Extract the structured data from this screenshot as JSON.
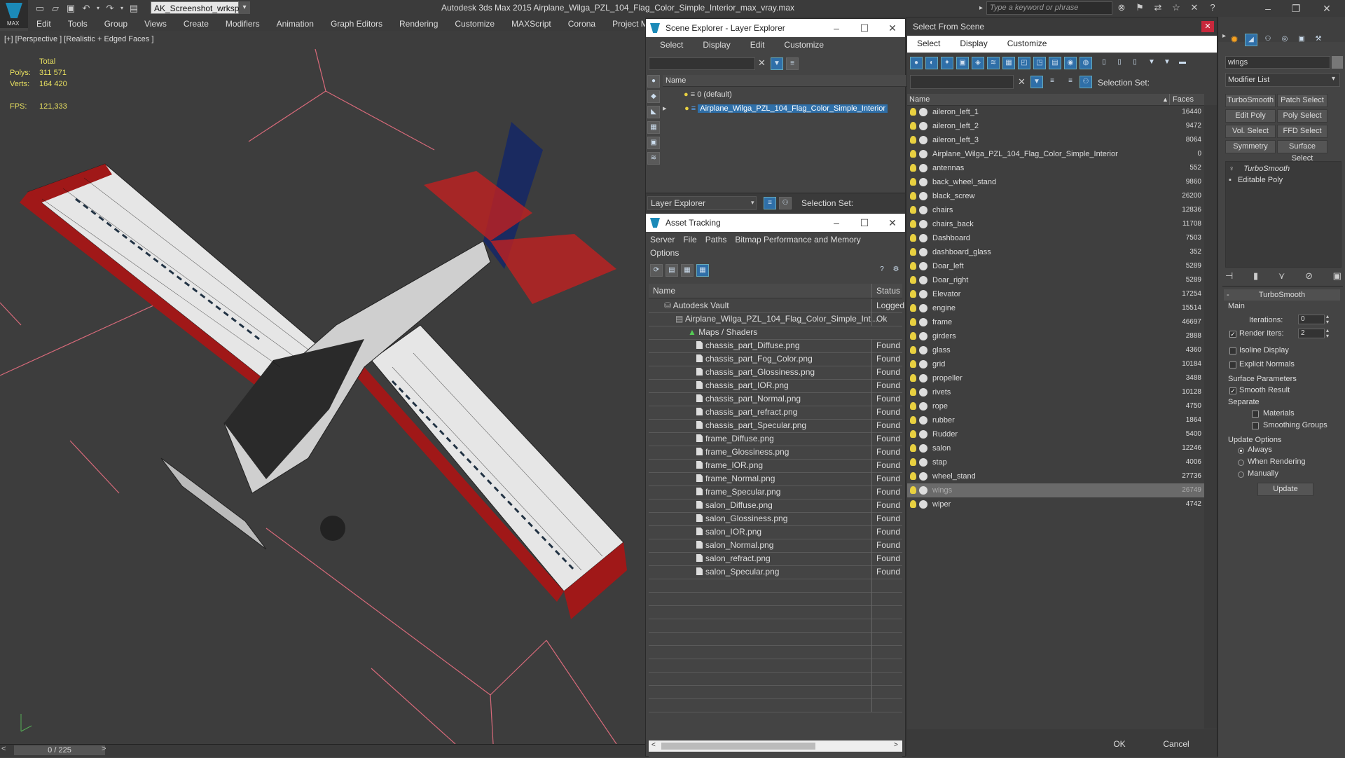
{
  "app": {
    "title": "Autodesk 3ds Max  2015    Airplane_Wilga_PZL_104_Flag_Color_Simple_Interior_max_vray.max",
    "logo_text": "MAX",
    "workspace": "AK_Screenshot_wrksp",
    "search_placeholder": "Type a keyword or phrase",
    "menus": [
      "Edit",
      "Tools",
      "Group",
      "Views",
      "Create",
      "Modifiers",
      "Animation",
      "Graph Editors",
      "Rendering",
      "Customize",
      "MAXScript",
      "Corona",
      "Project Man"
    ]
  },
  "viewport": {
    "label": "[+] [Perspective ] [Realistic + Edged Faces ]",
    "stats_total_label": "Total",
    "polys_label": "Polys:",
    "polys": "311 571",
    "verts_label": "Verts:",
    "verts": "164 420",
    "fps_label": "FPS:",
    "fps": "121,333"
  },
  "timeline": {
    "frame": "0 / 225"
  },
  "scene_explorer": {
    "title": "Scene Explorer - Layer Explorer",
    "menus": [
      "Select",
      "Display",
      "Edit",
      "Customize"
    ],
    "col_name": "Name",
    "layers": [
      "0 (default)",
      "Airplane_Wilga_PZL_104_Flag_Color_Simple_Interior"
    ],
    "footer_combo": "Layer Explorer",
    "selection_set_label": "Selection Set:"
  },
  "asset_tracking": {
    "title": "Asset Tracking",
    "menus": [
      "Server",
      "File",
      "Paths",
      "Bitmap Performance and Memory",
      "Options"
    ],
    "col_name": "Name",
    "col_status": "Status",
    "vault": {
      "name": "Autodesk Vault",
      "status": "Logged"
    },
    "file": {
      "name": "Airplane_Wilga_PZL_104_Flag_Color_Simple_Int...",
      "status": "Ok"
    },
    "group": "Maps / Shaders",
    "maps": [
      {
        "name": "chassis_part_Diffuse.png",
        "status": "Found"
      },
      {
        "name": "chassis_part_Fog_Color.png",
        "status": "Found"
      },
      {
        "name": "chassis_part_Glossiness.png",
        "status": "Found"
      },
      {
        "name": "chassis_part_IOR.png",
        "status": "Found"
      },
      {
        "name": "chassis_part_Normal.png",
        "status": "Found"
      },
      {
        "name": "chassis_part_refract.png",
        "status": "Found"
      },
      {
        "name": "chassis_part_Specular.png",
        "status": "Found"
      },
      {
        "name": "frame_Diffuse.png",
        "status": "Found"
      },
      {
        "name": "frame_Glossiness.png",
        "status": "Found"
      },
      {
        "name": "frame_IOR.png",
        "status": "Found"
      },
      {
        "name": "frame_Normal.png",
        "status": "Found"
      },
      {
        "name": "frame_Specular.png",
        "status": "Found"
      },
      {
        "name": "salon_Diffuse.png",
        "status": "Found"
      },
      {
        "name": "salon_Glossiness.png",
        "status": "Found"
      },
      {
        "name": "salon_IOR.png",
        "status": "Found"
      },
      {
        "name": "salon_Normal.png",
        "status": "Found"
      },
      {
        "name": "salon_refract.png",
        "status": "Found"
      },
      {
        "name": "salon_Specular.png",
        "status": "Found"
      }
    ]
  },
  "select_from_scene": {
    "title": "Select From Scene",
    "menus": [
      "Select",
      "Display",
      "Customize"
    ],
    "selection_set_label": "Selection Set:",
    "col_name": "Name",
    "col_faces": "Faces",
    "objects": [
      {
        "name": "aileron_left_1",
        "faces": "16440"
      },
      {
        "name": "aileron_left_2",
        "faces": "9472"
      },
      {
        "name": "aileron_left_3",
        "faces": "8064"
      },
      {
        "name": "Airplane_Wilga_PZL_104_Flag_Color_Simple_Interior",
        "faces": "0"
      },
      {
        "name": "antennas",
        "faces": "552"
      },
      {
        "name": "back_wheel_stand",
        "faces": "9860"
      },
      {
        "name": "black_screw",
        "faces": "26200"
      },
      {
        "name": "chairs",
        "faces": "12836"
      },
      {
        "name": "chairs_back",
        "faces": "11708"
      },
      {
        "name": "Dashboard",
        "faces": "7503"
      },
      {
        "name": "dashboard_glass",
        "faces": "352"
      },
      {
        "name": "Doar_left",
        "faces": "5289"
      },
      {
        "name": "Doar_right",
        "faces": "5289"
      },
      {
        "name": "Elevator",
        "faces": "17254"
      },
      {
        "name": "engine",
        "faces": "15514"
      },
      {
        "name": "frame",
        "faces": "46697"
      },
      {
        "name": "girders",
        "faces": "2888"
      },
      {
        "name": "glass",
        "faces": "4360"
      },
      {
        "name": "grid",
        "faces": "10184"
      },
      {
        "name": "propeller",
        "faces": "3488"
      },
      {
        "name": "rivets",
        "faces": "10128"
      },
      {
        "name": "rope",
        "faces": "4750"
      },
      {
        "name": "rubber",
        "faces": "1864"
      },
      {
        "name": "Rudder",
        "faces": "5400"
      },
      {
        "name": "salon",
        "faces": "12246"
      },
      {
        "name": "stap",
        "faces": "4006"
      },
      {
        "name": "wheel_stand",
        "faces": "27736"
      },
      {
        "name": "wings",
        "faces": "26749"
      },
      {
        "name": "wiper",
        "faces": "4742"
      }
    ],
    "ok": "OK",
    "cancel": "Cancel"
  },
  "command_panel": {
    "object_name": "wings",
    "modifier_list": "Modifier List",
    "buttons": [
      "TurboSmooth",
      "Patch Select",
      "Edit Poly",
      "Poly Select",
      "Vol. Select",
      "FFD Select",
      "Symmetry",
      "Surface Select"
    ],
    "stack": [
      "TurboSmooth",
      "Editable Poly"
    ],
    "rollout_title": "TurboSmooth",
    "main_label": "Main",
    "iterations_label": "Iterations:",
    "iterations": "0",
    "render_iters_label": "Render Iters:",
    "render_iters": "2",
    "isoline": "Isoline Display",
    "explicit_normals": "Explicit Normals",
    "surface_params": "Surface Parameters",
    "smooth_result": "Smooth Result",
    "separate": "Separate",
    "materials": "Materials",
    "smoothing_groups": "Smoothing Groups",
    "update_options": "Update Options",
    "always": "Always",
    "when_rendering": "When Rendering",
    "manually": "Manually",
    "update": "Update"
  }
}
